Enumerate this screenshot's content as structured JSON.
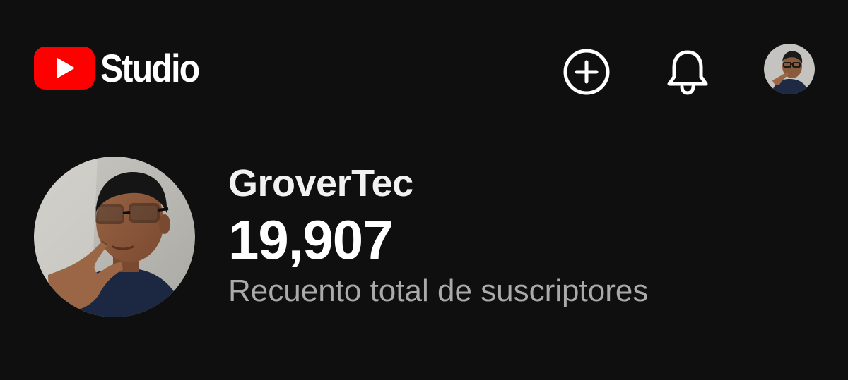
{
  "app": {
    "logo_text": "Studio",
    "brand_color": "#ff0000",
    "background": "#0f0f0f"
  },
  "header": {
    "actions": [
      {
        "icon": "plus-circle-icon",
        "name": "create"
      },
      {
        "icon": "bell-icon",
        "name": "notifications"
      },
      {
        "icon": "account-avatar",
        "name": "account"
      }
    ]
  },
  "channel": {
    "name": "GroverTec",
    "subscriber_count": "19,907",
    "subscriber_label": "Recuento total de suscriptores"
  }
}
